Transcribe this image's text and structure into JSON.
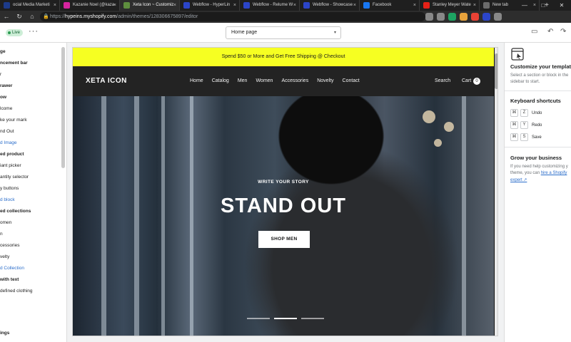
{
  "browser": {
    "tabs": [
      {
        "title": "ocial Media Marketi",
        "fav": "#1d3b8a"
      },
      {
        "title": "Kazanie Noel (@kaza",
        "fav": "#d6249f"
      },
      {
        "title": "Xeta Icon ~ Customiz",
        "fav": "#5e8e3e"
      },
      {
        "title": "Webflow - HyperLin",
        "fav": "#2b45c9"
      },
      {
        "title": "Webflow - Relume W",
        "fav": "#2b45c9"
      },
      {
        "title": "Webflow - Showcase",
        "fav": "#2b45c9"
      },
      {
        "title": "Facebook",
        "fav": "#1877f2"
      },
      {
        "title": "Stanley Meyer Wate",
        "fav": "#e62117"
      },
      {
        "title": "New tab",
        "fav": "#6b6b6b"
      }
    ],
    "close_glyph": "×",
    "new_tab_glyph": "+",
    "window_controls": [
      "—",
      "□",
      "✕"
    ],
    "back_glyph": "←",
    "refresh_glyph": "↻",
    "home_glyph": "⌂",
    "lock_glyph": "🔒",
    "url_prefix": "https://",
    "url_host": "hypeins.myshopify.com",
    "url_path": "/admin/themes/128306675897/editor",
    "extension_colors": [
      "#888888",
      "#888888",
      "#1da462",
      "#e8a33c",
      "#e94235",
      "#2b45c9",
      "#888888"
    ]
  },
  "editor": {
    "status_badge": "Live",
    "more_menu": "···",
    "page_selector": "Home page",
    "page_selector_caret": "▾",
    "device_icon_glyph": "▭",
    "undo_glyph": "↶",
    "redo_glyph": "↷"
  },
  "sidebar": {
    "items": [
      {
        "label": "ge",
        "style": "bold"
      },
      {
        "label": "ncement bar",
        "style": "bold"
      },
      {
        "label": "r",
        "style": "normal"
      },
      {
        "label": "rawer",
        "style": "bold"
      },
      {
        "label": "ow",
        "style": "bold"
      },
      {
        "label": "lcome",
        "style": "normal"
      },
      {
        "label": "ke your mark",
        "style": "normal"
      },
      {
        "label": "nd Out",
        "style": "normal"
      },
      {
        "label": "d Image",
        "style": "link"
      },
      {
        "label": "ed product",
        "style": "bold"
      },
      {
        "label": "iant picker",
        "style": "normal"
      },
      {
        "label": "antity selector",
        "style": "normal"
      },
      {
        "label": "y buttons",
        "style": "normal"
      },
      {
        "label": "d block",
        "style": "link"
      },
      {
        "label": "ed collections",
        "style": "bold"
      },
      {
        "label": "omen",
        "style": "normal"
      },
      {
        "label": "n",
        "style": "normal"
      },
      {
        "label": "cessories",
        "style": "normal"
      },
      {
        "label": "velty",
        "style": "normal"
      },
      {
        "label": "d Collection",
        "style": "link"
      },
      {
        "label": "with text",
        "style": "bold"
      },
      {
        "label": "defined clothing",
        "style": "normal"
      },
      {
        "label": "ings",
        "style": "bold"
      }
    ]
  },
  "preview": {
    "announcement": "Spend $50 or More and Get Free Shipping @ Checkout",
    "logo": "XETA ICON",
    "nav": [
      "Home",
      "Catalog",
      "Men",
      "Women",
      "Accessories",
      "Novelty",
      "Contact"
    ],
    "search": "Search",
    "cart": "Cart",
    "cart_count": "0",
    "hero": {
      "subheading": "WRITE YOUR STORY",
      "heading": "STAND OUT",
      "button": "SHOP MEN",
      "slide_count": 3,
      "active_slide": 1
    }
  },
  "right_panel": {
    "customize_title": "Customize your templates",
    "customize_text": [
      "Select a section or block in the",
      "sidebar to start."
    ],
    "shortcuts_title": "Keyboard shortcuts",
    "shortcuts": [
      {
        "key": "Z",
        "action": "Undo"
      },
      {
        "key": "Y",
        "action": "Redo"
      },
      {
        "key": "S",
        "action": "Save"
      }
    ],
    "modifier_glyph": "⌘",
    "grow_title": "Grow your business",
    "grow_text_1": "If you need help customizing y",
    "grow_text_2": "theme, you can",
    "grow_link": "hire a Shopify",
    "grow_link_2": "expert ↗"
  }
}
